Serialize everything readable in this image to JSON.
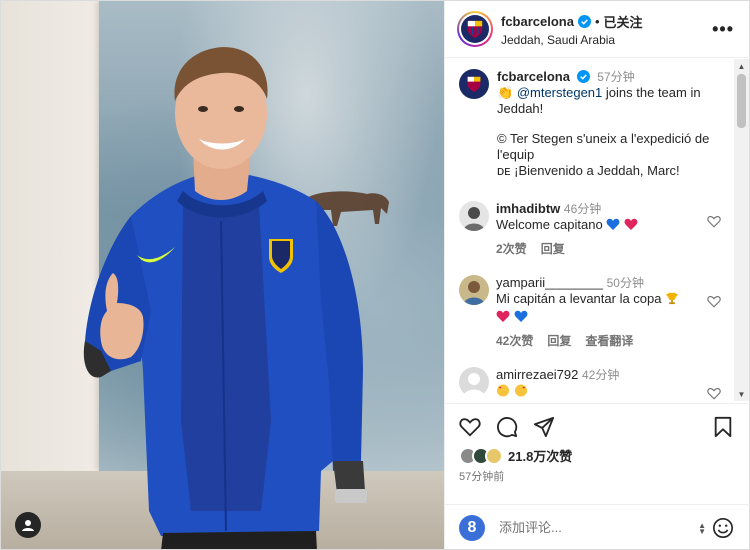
{
  "post": {
    "account": "fcbarcelona",
    "follow_status": "已关注",
    "separator": "•",
    "location": "Jeddah, Saudi Arabia",
    "more_label": "•••"
  },
  "caption": {
    "account": "fcbarcelona",
    "time": "57分钟",
    "line1_emoji": "👏",
    "mention": "@mterstegen1",
    "line1_rest": "joins the team in Jeddah!",
    "line2": "© Ter Stegen s'uneix a l'expedició de l'equip",
    "line3_prefix": "ᴅᴇ",
    "line3": "¡Bienvenido a Jeddah, Marc!"
  },
  "comments": [
    {
      "user": "imhadibtw",
      "time": "46分钟",
      "text": "Welcome capitano",
      "likes": "2次赞",
      "reply": "回复",
      "translate": ""
    },
    {
      "user": "yamparii________",
      "time": "50分钟",
      "text": "Mi capitán a levantar la copa",
      "likes": "42次赞",
      "reply": "回复",
      "translate": "查看翻译"
    },
    {
      "user": "amirrezaei792",
      "time": "42分钟",
      "text": "",
      "likes": "",
      "reply": "",
      "translate": ""
    }
  ],
  "engagement": {
    "likes_count": "21.8万次赞",
    "posted_ago": "57分钟前"
  },
  "composer": {
    "avatar_letter": "8",
    "placeholder": "添加评论..."
  },
  "icons": {
    "like": "heart-icon",
    "comment": "comment-icon",
    "share": "share-icon",
    "save": "bookmark-icon",
    "emoji": "emoji-icon"
  },
  "colors": {
    "kit_blue": "#1f4fc0",
    "verified_blue": "#0095f6",
    "heart_red": "#e0245e"
  }
}
